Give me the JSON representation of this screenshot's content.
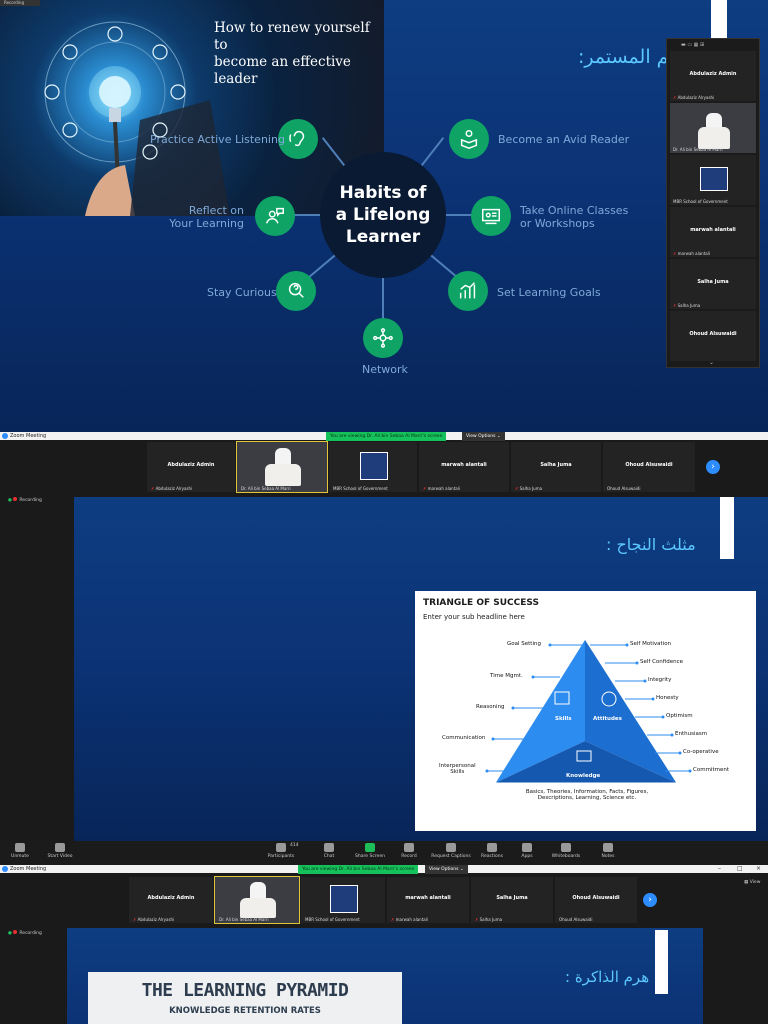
{
  "section1": {
    "recording_chip": "Recording",
    "photo_title_line1": "How to renew yourself to",
    "photo_title_line2": "become an effective leader",
    "arabic_title": "هم المستمر:",
    "hub_line1": "Habits of",
    "hub_line2": "a Lifelong",
    "hub_line3": "Learner",
    "habits": [
      {
        "label_line1": "Practice Active Listening",
        "label_line2": "",
        "icon": "ear-icon"
      },
      {
        "label_line1": "Become an Avid Reader",
        "label_line2": "",
        "icon": "reader-icon"
      },
      {
        "label_line1": "Reflect on",
        "label_line2": "Your Learning",
        "icon": "reflect-icon"
      },
      {
        "label_line1": "Take Online Classes",
        "label_line2": "or Workshops",
        "icon": "online-class-icon"
      },
      {
        "label_line1": "Stay Curious",
        "label_line2": "",
        "icon": "magnifier-icon"
      },
      {
        "label_line1": "Set Learning Goals",
        "label_line2": "",
        "icon": "chart-icon"
      },
      {
        "label_line1": "Network",
        "label_line2": "",
        "icon": "network-icon"
      }
    ],
    "panel": {
      "tiles": [
        {
          "name": "Abdulaziz Admin",
          "sub": "Abdulaziz Alryashi"
        },
        {
          "name": "",
          "sub": "Dr. Ali bin Sebaa Al Marri"
        },
        {
          "name": "",
          "sub": "MBR School of Government"
        },
        {
          "name": "marwah alantali",
          "sub": "marwah alantali"
        },
        {
          "name": "Salha Juma",
          "sub": "Salha Juma"
        },
        {
          "name": "Ohoud Alsuwaidi",
          "sub": ""
        }
      ]
    }
  },
  "zoom1": {
    "window_title": "Zoom Meeting",
    "share_notice": "You are viewing Dr. Ali bin Sebaa Al Marri's screen",
    "view_options": "View Options",
    "participants": [
      {
        "name": "Abdulaziz Admin",
        "sub": "Abdulaziz Alryashi"
      },
      {
        "name": "",
        "sub": "Dr. Ali bin Sebaa Al Marri"
      },
      {
        "name": "",
        "sub": "MBR School of Government"
      },
      {
        "name": "marwah alantali",
        "sub": "marwah alantali"
      },
      {
        "name": "Salha Juma",
        "sub": "Salha Juma"
      },
      {
        "name": "Ohoud Alsuwaidi",
        "sub": "Ohoud Alsuwaidi"
      }
    ],
    "next_arrow": "›",
    "recording": "Recording"
  },
  "section2": {
    "arabic_title": "مثلث النجاح :",
    "card_title": "TRIANGLE OF SUCCESS",
    "card_subtitle": "Enter your sub headline here",
    "left_labels": [
      "Goal Setting",
      "Time Mgmt.",
      "Reasoning",
      "Communication",
      "Interpersonal",
      "Skills"
    ],
    "right_labels": [
      "Self Motivation",
      "Self Confidence",
      "Integrity",
      "Honesty",
      "Optimism",
      "Enthusiasm",
      "Co-operative",
      "Commitment"
    ],
    "inner_labels": [
      "Skills",
      "Attitudes",
      "Knowledge"
    ],
    "bottom_line1": "Basics, Theories, Information, Facts, Figures,",
    "bottom_line2": "Descriptions, Learning, Science etc."
  },
  "toolbar": {
    "items": [
      "Unmute",
      "Start Video",
      "Participants",
      "Chat",
      "Share Screen",
      "Record",
      "Request Captions",
      "Reactions",
      "Apps",
      "Whiteboards",
      "Notes"
    ],
    "participants_count": "414"
  },
  "zoom2": {
    "window_title": "Zoom Meeting",
    "share_notice": "You are viewing Dr. Ali bin Sebaa Al Marri's screen",
    "view_options": "View Options",
    "view_label": "View",
    "participants": [
      {
        "name": "Abdulaziz Admin",
        "sub": "Abdulaziz Alryashi"
      },
      {
        "name": "",
        "sub": "Dr. Ali bin Sebaa Al Marri"
      },
      {
        "name": "",
        "sub": "MBR School of Government"
      },
      {
        "name": "marwah alantali",
        "sub": "marwah alantali"
      },
      {
        "name": "Salha Juma",
        "sub": "Salha Juma"
      },
      {
        "name": "Ohoud Alsuwaidi",
        "sub": "Ohoud Alsuwaidi"
      }
    ],
    "next_arrow": "›",
    "recording": "Recording"
  },
  "section3": {
    "arabic_title": "هرم الذاكرة :",
    "card_title": "THE LEARNING PYRAMID",
    "card_subtitle": "KNOWLEDGE RETENTION RATES"
  },
  "colors": {
    "accent_green": "#0fa466",
    "zoom_blue": "#2d8cff",
    "slide_blue": "#0b3274",
    "arabic_cyan": "#5bc8ff"
  }
}
